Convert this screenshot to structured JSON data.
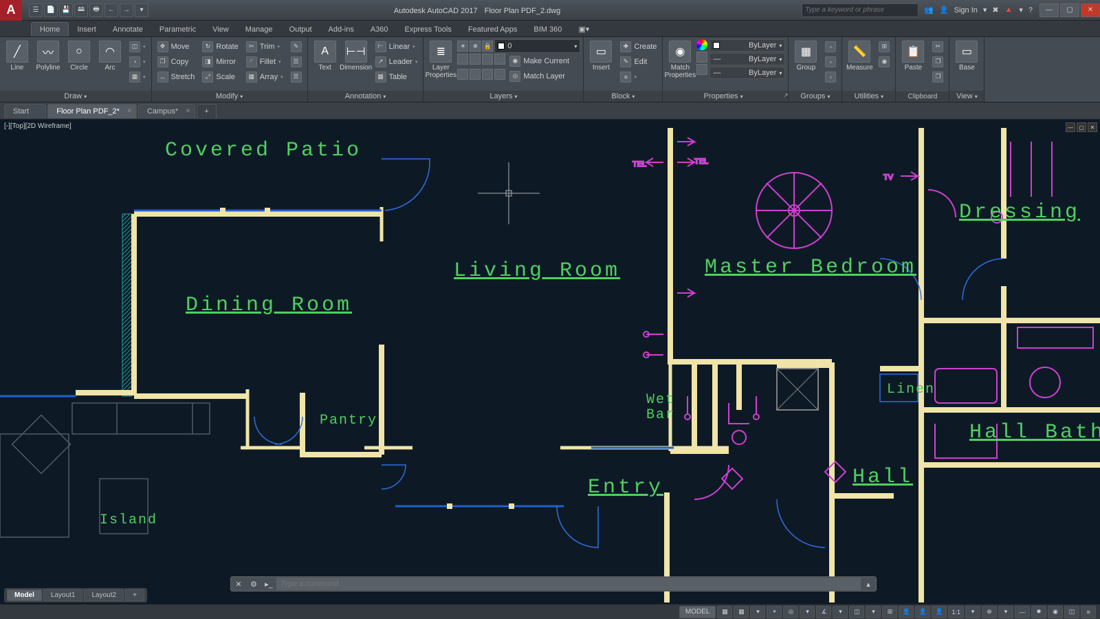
{
  "app": {
    "title": "Autodesk AutoCAD 2017",
    "document": "Floor Plan PDF_2.dwg",
    "logo": "A"
  },
  "qat": [
    "☰",
    "📄",
    "💾",
    "🖴",
    "🖶",
    "←",
    "→",
    "▾",
    "▾"
  ],
  "search": {
    "placeholder": "Type a keyword or phrase"
  },
  "signin": {
    "label": "Sign In",
    "icons": [
      "👥",
      "👤",
      "▾",
      "✖",
      "🔺",
      "▾",
      "?",
      "ⓘ"
    ]
  },
  "window": {
    "min": "—",
    "max": "▢",
    "close": "✕"
  },
  "menu_tabs": [
    "Home",
    "Insert",
    "Annotate",
    "Parametric",
    "View",
    "Manage",
    "Output",
    "Add-ins",
    "A360",
    "Express Tools",
    "Featured Apps",
    "BIM 360"
  ],
  "menu_active": 0,
  "ribbon": {
    "draw": {
      "title": "Draw",
      "items": [
        {
          "label": "Line",
          "icon": "╱"
        },
        {
          "label": "Polyline",
          "icon": "〰"
        },
        {
          "label": "Circle",
          "icon": "○"
        },
        {
          "label": "Arc",
          "icon": "◠"
        }
      ],
      "stack": [
        "◫",
        "◔",
        "▦"
      ]
    },
    "modify": {
      "title": "Modify",
      "rows": [
        [
          "Move",
          "Rotate",
          "Trim"
        ],
        [
          "Copy",
          "Mirror",
          "Fillet"
        ],
        [
          "Stretch",
          "Scale",
          "Array"
        ]
      ],
      "side": [
        "✎",
        "☰",
        "☰"
      ]
    },
    "annotation": {
      "title": "Annotation",
      "big": [
        {
          "label": "Text",
          "icon": "A"
        },
        {
          "label": "Dimension",
          "icon": "⊢⊣"
        }
      ],
      "rows": [
        "Linear",
        "Leader",
        "Table"
      ]
    },
    "layers": {
      "title": "Layers",
      "big": {
        "label": "Layer\nProperties",
        "icon": "≣"
      },
      "current_layer": "0",
      "rows": [
        "Make Current",
        "Match Layer"
      ],
      "icons": [
        "☀",
        "❄",
        "🔒",
        "◧",
        "◨",
        "◩",
        "◪",
        "◫",
        "◬"
      ]
    },
    "block": {
      "title": "Block",
      "big": {
        "label": "Insert",
        "icon": "▭"
      },
      "rows": [
        "Create",
        "Edit"
      ]
    },
    "properties": {
      "title": "Properties",
      "big": {
        "label": "Match\nProperties",
        "icon": "◉"
      },
      "combos": [
        "ByLayer",
        "ByLayer",
        "ByLayer"
      ]
    },
    "groups": {
      "title": "Groups",
      "big": {
        "label": "Group",
        "icon": "▦"
      }
    },
    "utilities": {
      "title": "Utilities",
      "big": {
        "label": "Measure",
        "icon": "📏"
      }
    },
    "clipboard": {
      "title": "Clipboard",
      "big": {
        "label": "Paste",
        "icon": "📋"
      }
    },
    "view": {
      "title": "View",
      "big": {
        "label": "Base",
        "icon": "▭"
      }
    }
  },
  "file_tabs": [
    {
      "label": "Start",
      "active": false,
      "close": false
    },
    {
      "label": "Floor Plan PDF_2*",
      "active": true,
      "close": true
    },
    {
      "label": "Campus*",
      "active": false,
      "close": true
    }
  ],
  "viewport": {
    "label": "[-][Top][2D Wireframe]"
  },
  "rooms": {
    "covered_patio": "Covered Patio",
    "living_room": "Living Room",
    "master_bedroom": "Master Bedroom",
    "dining_room": "Dining Room",
    "dressing": "Dressing",
    "pantry": "Pantry",
    "wet_bar_1": "Wet",
    "wet_bar_2": "Bar",
    "linen": "Linen",
    "hall_bath": "Hall Bath",
    "hall": "Hall",
    "entry": "Entry",
    "island": "Island"
  },
  "symbols": {
    "tel": "TEL",
    "tv": "TV"
  },
  "command": {
    "placeholder": "Type a command"
  },
  "layout_tabs": [
    "Model",
    "Layout1",
    "Layout2",
    "+"
  ],
  "layout_active": 0,
  "status": {
    "model": "MODEL",
    "scale": "1:1",
    "icons": [
      "▦",
      "▦",
      "▾",
      "⌖",
      "◎",
      "▾",
      "∡",
      "▾",
      "◫",
      "▾",
      "⊞",
      "👤",
      "👤",
      "👤",
      "▾",
      "⊕",
      "▾",
      "—",
      "✹",
      "◉",
      "◫",
      "≡",
      "▾"
    ]
  }
}
